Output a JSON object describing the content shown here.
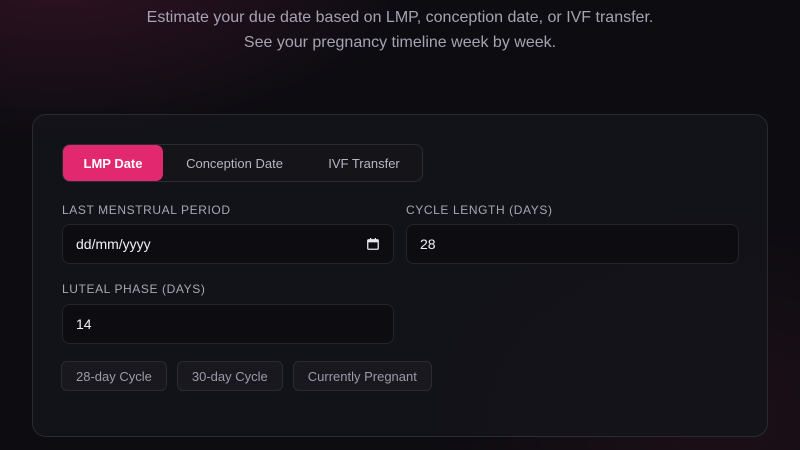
{
  "header": {
    "subtitle_line1": "Estimate your due date based on LMP, conception date, or IVF transfer.",
    "subtitle_line2": "See your pregnancy timeline week by week."
  },
  "tabs": [
    {
      "label": "LMP Date",
      "active": true
    },
    {
      "label": "Conception Date",
      "active": false
    },
    {
      "label": "IVF Transfer",
      "active": false
    }
  ],
  "form": {
    "lmp": {
      "label": "Last Menstrual Period",
      "placeholder": "dd/mm/yyyy",
      "value": ""
    },
    "cycle_length": {
      "label": "Cycle Length (days)",
      "value": "28"
    },
    "luteal_phase": {
      "label": "Luteal Phase (days)",
      "value": "14"
    }
  },
  "presets": [
    {
      "label": "28-day Cycle"
    },
    {
      "label": "30-day Cycle"
    },
    {
      "label": "Currently Pregnant"
    }
  ],
  "colors": {
    "accent": "#e2296f",
    "card_bg": "#14141a",
    "page_bg": "#0c0c11"
  },
  "icons": {
    "date_picker": "calendar-icon"
  }
}
